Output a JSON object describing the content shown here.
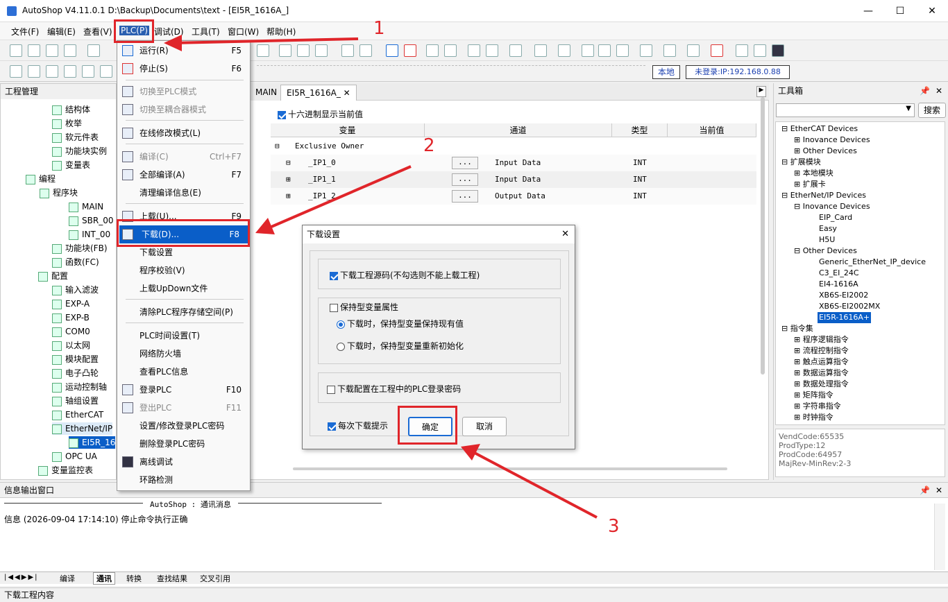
{
  "window": {
    "title": "AutoShop V4.11.0.1  D:\\Backup\\Documents\\text - [EI5R_1616A_]"
  },
  "menubar": [
    "文件(F)",
    "编辑(E)",
    "查看(V)",
    "PLC(P)",
    "调试(D)",
    "工具(T)",
    "窗口(W)",
    "帮助(H)"
  ],
  "toolbar2": {
    "local_label": "本地",
    "login_status": "未登录:IP:192.168.0.88"
  },
  "left_panel": {
    "title": "工程管理",
    "items": [
      "结构体",
      "枚举",
      "软元件表",
      "功能块实例",
      "变量表",
      "编程",
      "程序块",
      "MAIN",
      "SBR_00",
      "INT_00",
      "功能块(FB)",
      "函数(FC)",
      "配置",
      "输入滤波",
      "EXP-A",
      "EXP-B",
      "COM0",
      "以太网",
      "模块配置",
      "电子凸轮",
      "运动控制轴",
      "轴组设置",
      "EtherCAT",
      "EtherNet/IP",
      "EI5R_16",
      "OPC UA",
      "变量监控表"
    ]
  },
  "editor": {
    "tab_main": "MAIN",
    "tab_active": "EI5R_1616A_",
    "hex_checkbox": "十六进制显示当前值",
    "columns": [
      "变量",
      "通道",
      "类型",
      "当前值"
    ],
    "group": "Exclusive Owner",
    "rows": [
      {
        "var": "_IP1_0",
        "btn": "...",
        "channel": "Input Data",
        "type": "INT"
      },
      {
        "var": "_IP1_1",
        "btn": "...",
        "channel": "Input Data",
        "type": "INT"
      },
      {
        "var": "_IP1_2",
        "btn": "...",
        "channel": "Output Data",
        "type": "INT"
      }
    ]
  },
  "plc_menu": {
    "items": [
      {
        "label": "运行(R)",
        "shortcut": "F5"
      },
      {
        "label": "停止(S)",
        "shortcut": "F6"
      },
      {
        "label": "切换至PLC模式",
        "shortcut": ""
      },
      {
        "label": "切换至耦合器模式",
        "shortcut": ""
      },
      {
        "label": "在线修改模式(L)",
        "shortcut": ""
      },
      {
        "label": "编译(C)",
        "shortcut": "Ctrl+F7"
      },
      {
        "label": "全部编译(A)",
        "shortcut": "F7"
      },
      {
        "label": "清理编译信息(E)",
        "shortcut": ""
      },
      {
        "label": "上载(U)...",
        "shortcut": "F9"
      },
      {
        "label": "下载(D)...",
        "shortcut": "F8"
      },
      {
        "label": "下载设置",
        "shortcut": ""
      },
      {
        "label": "程序校验(V)",
        "shortcut": ""
      },
      {
        "label": "上载UpDown文件",
        "shortcut": ""
      },
      {
        "label": "清除PLC程序存储空间(P)",
        "shortcut": ""
      },
      {
        "label": "PLC时间设置(T)",
        "shortcut": ""
      },
      {
        "label": "网络防火墙",
        "shortcut": ""
      },
      {
        "label": "查看PLC信息",
        "shortcut": ""
      },
      {
        "label": "登录PLC",
        "shortcut": "F10"
      },
      {
        "label": "登出PLC",
        "shortcut": "F11"
      },
      {
        "label": "设置/修改登录PLC密码",
        "shortcut": ""
      },
      {
        "label": "删除登录PLC密码",
        "shortcut": ""
      },
      {
        "label": "离线调试",
        "shortcut": ""
      },
      {
        "label": "环路检测",
        "shortcut": ""
      }
    ]
  },
  "dialog": {
    "title": "下载设置",
    "opt_source": "下载工程源码(不勾选则不能上载工程)",
    "opt_retain": "保持型变量属性",
    "radio_keep": "下载时，保持型变量保持现有值",
    "radio_reinit": "下载时，保持型变量重新初始化",
    "opt_password": "下载配置在工程中的PLC登录密码",
    "opt_prompt": "每次下载提示",
    "ok": "确定",
    "cancel": "取消"
  },
  "toolbox": {
    "title": "工具箱",
    "search_btn": "搜索",
    "tree": [
      "EtherCAT Devices",
      "Inovance Devices",
      "Other Devices",
      "扩展模块",
      "本地模块",
      "扩展卡",
      "EtherNet/IP Devices",
      "Inovance Devices",
      "EIP_Card",
      "Easy",
      "H5U",
      "Other Devices",
      "Generic_EtherNet_IP_device",
      "C3_EI_24C",
      "EI4-1616A",
      "XB6S-EI2002",
      "XB6S-EI2002MX",
      "EI5R-1616A+",
      "指令集",
      "程序逻辑指令",
      "流程控制指令",
      "触点运算指令",
      "数据运算指令",
      "数据处理指令",
      "矩阵指令",
      "字符串指令",
      "时钟指令"
    ],
    "info": [
      "VendCode:65535",
      "ProdType:12",
      "ProdCode:64957",
      "MajRev-MinRev:2-3"
    ]
  },
  "output": {
    "title": "信息输出窗口",
    "header": "AutoShop : 通讯消息",
    "line": "信息  (2026-09-04 17:14:10)  停止命令执行正确",
    "tabs": [
      "编译",
      "通讯",
      "转换",
      "查找结果",
      "交叉引用"
    ]
  },
  "statusbar": "下载工程内容",
  "annotations": [
    "1",
    "2",
    "3"
  ]
}
